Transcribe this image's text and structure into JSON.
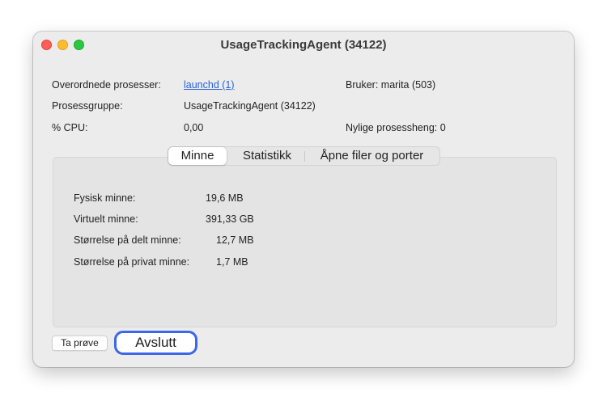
{
  "window": {
    "title": "UsageTrackingAgent (34122)"
  },
  "info": {
    "parent_label": "Overordnede prosesser:",
    "parent_value": "launchd (1)",
    "group_label": "Prosessgruppe:",
    "group_value": "UsageTrackingAgent (34122)",
    "cpu_label": "% CPU:",
    "cpu_value": "0,00",
    "user_label": "Bruker:",
    "user_value": "marita (503)",
    "hangs_label": "Nylige prosessheng:",
    "hangs_value": "0"
  },
  "tabs": [
    {
      "label": "Minne",
      "selected": true
    },
    {
      "label": "Statistikk",
      "selected": false
    },
    {
      "label": "Åpne filer og porter",
      "selected": false
    }
  ],
  "memory": {
    "rows": [
      {
        "label": "Fysisk minne:",
        "value": "19,6 MB"
      },
      {
        "label": "Virtuelt minne:",
        "value": "391,33 GB"
      },
      {
        "label": "Størrelse på delt minne:",
        "value": "12,7 MB"
      },
      {
        "label": "Størrelse på privat minne:",
        "value": "1,7 MB"
      }
    ]
  },
  "buttons": {
    "sample_label": "Ta prøve",
    "quit_label": "Avslutt"
  },
  "colors": {
    "accent": "#3b67e8",
    "link": "#2a62d6",
    "close": "#ff5f57",
    "minimize": "#febc2e",
    "zoom": "#28c840"
  }
}
